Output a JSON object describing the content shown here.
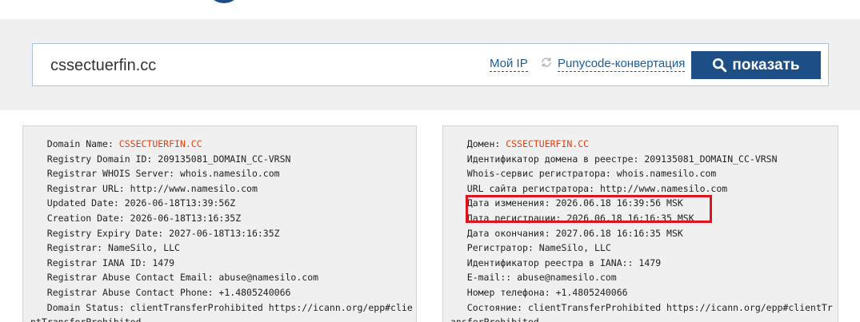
{
  "search": {
    "value": "cssectuerfin.cc",
    "my_ip_label": "Мой IP",
    "punycode_label": "Punycode-конвертация",
    "show_label": "показать"
  },
  "colors": {
    "brand": "#1d4f86",
    "link": "#1d5d9b",
    "accent": "#e0400f",
    "highlight": "#e0141e"
  },
  "whois_original": [
    {
      "label": "   Domain Name: ",
      "value": "CSSECTUERFIN.CC"
    },
    {
      "label": "   Registry Domain ID: ",
      "value": "209135081_DOMAIN_CC-VRSN"
    },
    {
      "label": "   Registrar WHOIS Server: ",
      "value": "whois.namesilo.com"
    },
    {
      "label": "   Registrar URL: ",
      "value": "http://www.namesilo.com"
    },
    {
      "label": "   Updated Date: ",
      "value": "2026-06-18T13:39:56Z"
    },
    {
      "label": "   Creation Date: ",
      "value": "2026-06-18T13:16:35Z"
    },
    {
      "label": "   Registry Expiry Date: ",
      "value": "2027-06-18T13:16:35Z"
    },
    {
      "label": "   Registrar: ",
      "value": "NameSilo, LLC"
    },
    {
      "label": "   Registrar IANA ID: ",
      "value": "1479"
    },
    {
      "label": "   Registrar Abuse Contact Email: ",
      "value": "abuse@namesilo.com"
    },
    {
      "label": "   Registrar Abuse Contact Phone: ",
      "value": "+1.4805240066"
    },
    {
      "label": "   Domain Status: ",
      "value": "clientTransferProhibited https://icann.org/epp#clientTransferProhibited"
    }
  ],
  "whois_translated": [
    {
      "label": "   Домен: ",
      "value": "CSSECTUERFIN.CC"
    },
    {
      "label": "   Идентификатор домена в реестре: ",
      "value": "209135081_DOMAIN_CC-VRSN"
    },
    {
      "label": "   Whois-сервис регистратора: ",
      "value": "whois.namesilo.com"
    },
    {
      "label": "   URL сайта регистратора: ",
      "value": "http://www.namesilo.com"
    },
    {
      "label": "   Дата изменения: ",
      "value": "2026.06.18 16:39:56 MSK"
    },
    {
      "label": "   Дата регистрации: ",
      "value": "2026.06.18 16:16:35 MSK"
    },
    {
      "label": "   Дата окончания: ",
      "value": "2027.06.18 16:16:35 MSK"
    },
    {
      "label": "   Регистратор: ",
      "value": "NameSilo, LLC"
    },
    {
      "label": "   Идентификатор реестра в IANA:: ",
      "value": "1479"
    },
    {
      "label": "   E-mail:: ",
      "value": "abuse@namesilo.com"
    },
    {
      "label": "   Номер телефона: ",
      "value": "+1.4805240066"
    },
    {
      "label": "   Состояние: ",
      "value": "clientTransferProhibited https://icann.org/epp#clientTransferProhibited"
    }
  ]
}
